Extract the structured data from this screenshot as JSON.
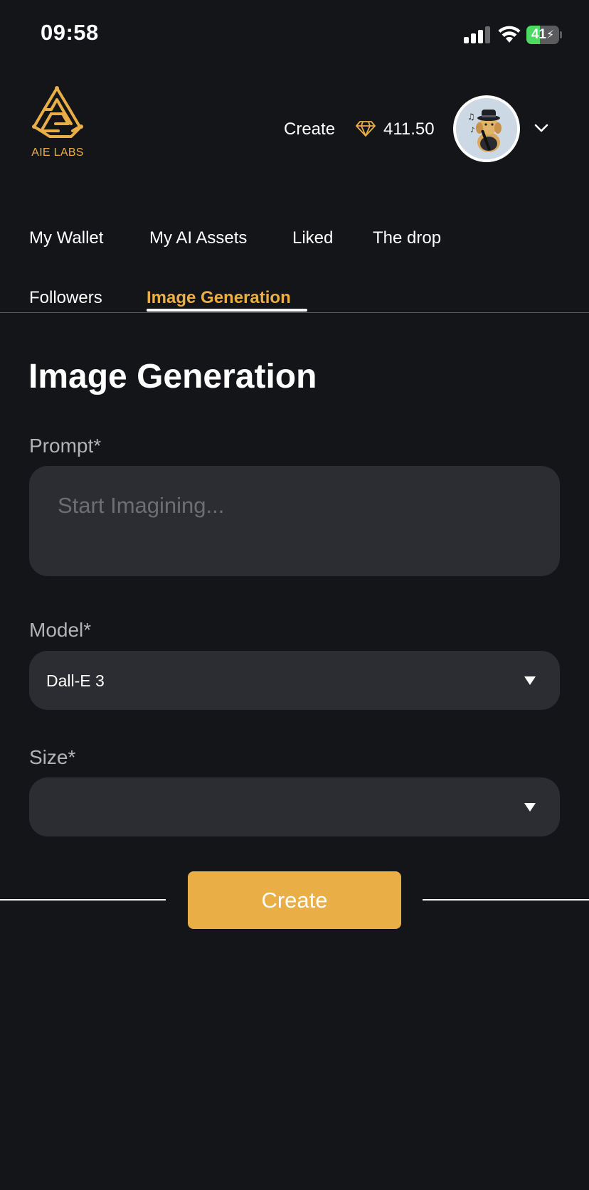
{
  "status_bar": {
    "time": "09:58",
    "battery": "41",
    "battery_level": 0.41
  },
  "header": {
    "logo_text": "AIE LABS",
    "create_label": "Create",
    "balance": "411.50",
    "icons": {
      "gem": "gem-icon",
      "chevron": "chevron-down-icon"
    }
  },
  "tabs": [
    {
      "label": "My Wallet"
    },
    {
      "label": "My AI Assets"
    },
    {
      "label": "Liked"
    },
    {
      "label": "The drop"
    },
    {
      "label": "Followers"
    },
    {
      "label": "Image Generation",
      "active": true
    }
  ],
  "form": {
    "title": "Image Generation",
    "prompt_label": "Prompt*",
    "prompt_placeholder": "Start Imagining...",
    "model_label": "Model*",
    "model_value": "Dall-E 3",
    "size_label": "Size*",
    "size_value": "",
    "create_button": "Create"
  },
  "colors": {
    "background": "#141519",
    "accent": "#e9ae46",
    "field": "#2c2d32"
  }
}
